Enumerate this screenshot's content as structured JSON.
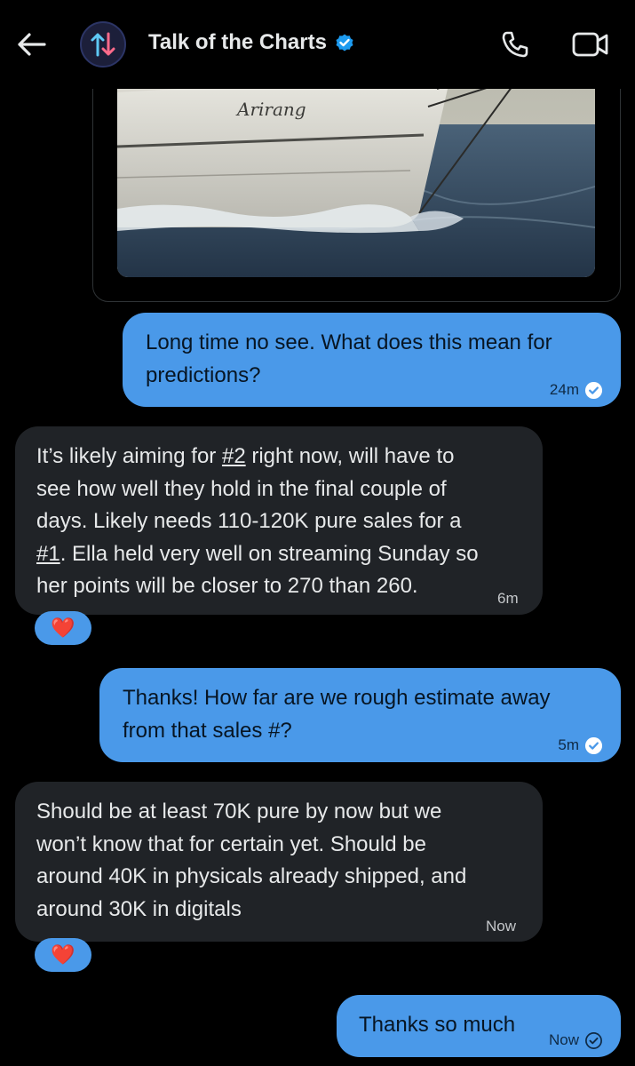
{
  "header": {
    "title": "Talk of the Charts",
    "back_icon": "arrow-left-icon",
    "avatar_icon": "up-down-arrows-icon",
    "verified_icon": "verified-badge-icon",
    "call_icon": "phone-icon",
    "video_icon": "video-camera-icon"
  },
  "media": {
    "ship_name": "Arirang"
  },
  "messages": [
    {
      "direction": "sent",
      "lines": [
        "Long time no see. What does this mean for",
        "predictions?"
      ],
      "time": "24m",
      "status_icon": "read-check-icon"
    },
    {
      "direction": "received",
      "line1_pre": "It’s likely aiming for ",
      "line1_link": "#2",
      "line1_post": " right now, will have to",
      "line2": "see how well they hold in the final couple of",
      "line3": "days. Likely needs 110-120K pure sales for a",
      "line4_link": "#1",
      "line4_post": ". Ella held very well on streaming Sunday so",
      "line5": "her points will be closer to 270 than 260.",
      "time": "6m",
      "reaction": "❤️"
    },
    {
      "direction": "sent",
      "lines": [
        "Thanks! How far are we rough estimate away",
        "from that sales #?"
      ],
      "time": "5m",
      "status_icon": "read-check-icon"
    },
    {
      "direction": "received",
      "lines": [
        "Should be at least 70K pure by now but we",
        "won’t know that for certain yet. Should be",
        "around 40K in physicals already shipped, and",
        "around 30K in digitals"
      ],
      "time": "Now",
      "reaction": "❤️"
    },
    {
      "direction": "sent",
      "lines": [
        "Thanks so much"
      ],
      "time": "Now",
      "status_icon": "sent-check-icon"
    }
  ],
  "colors": {
    "sent_bubble": "#4a99e9",
    "received_bubble": "#202327",
    "background": "#000000",
    "verified": "#1d9bf0"
  }
}
